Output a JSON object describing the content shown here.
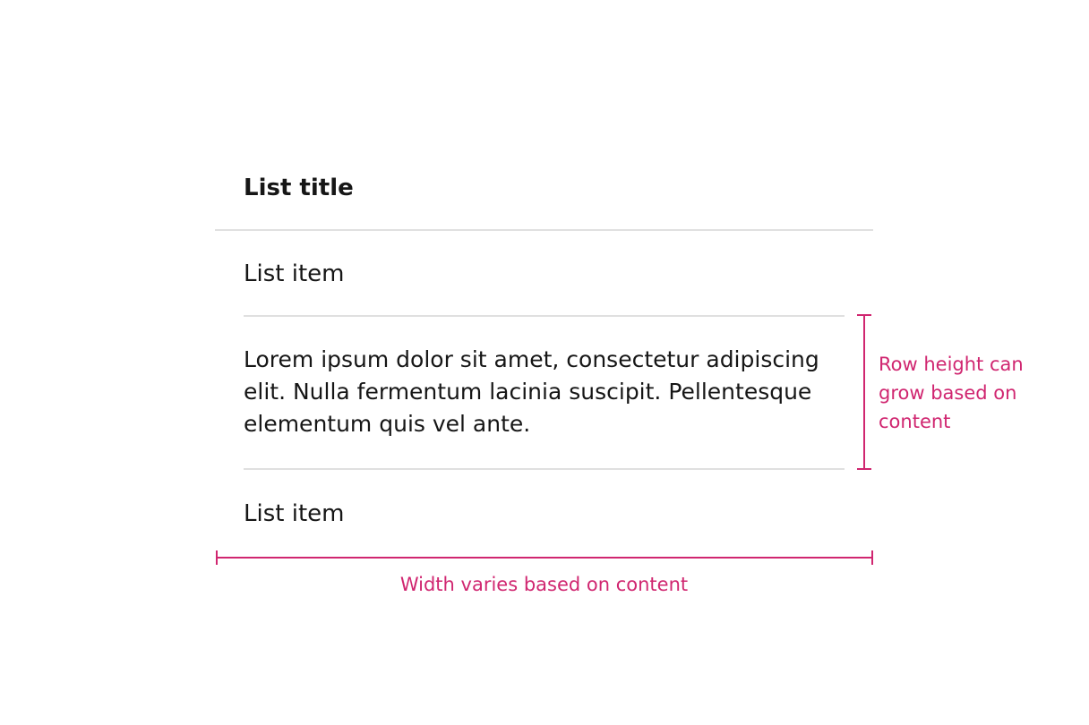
{
  "list": {
    "title": "List title",
    "items": [
      "List item",
      "Lorem ipsum dolor sit amet, consectetur adipiscing elit. Nulla fermentum lacinia suscipit. Pellentesque elementum quis vel ante.",
      "List item"
    ]
  },
  "annotations": {
    "row_height": "Row height can grow based on content",
    "width": "Width varies based on content",
    "color": "#d02670"
  },
  "colors": {
    "text": "#161616",
    "divider": "#e0e0e0",
    "annotation": "#d02670"
  }
}
